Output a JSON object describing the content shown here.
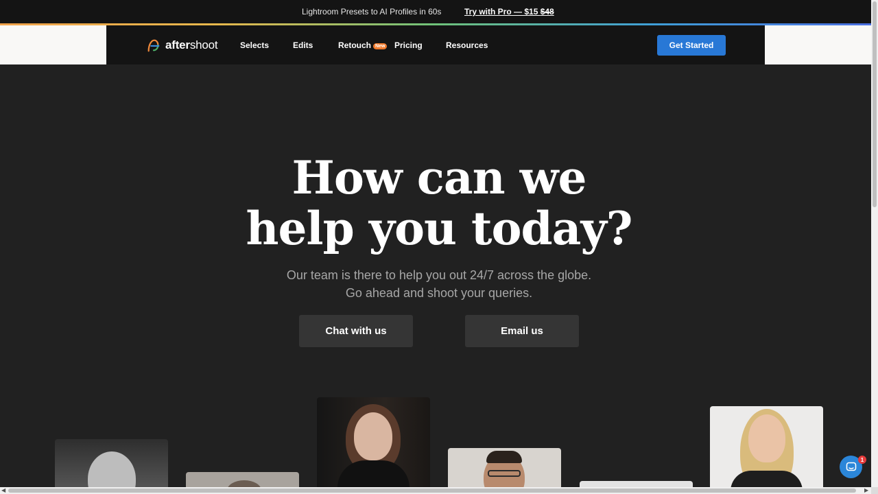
{
  "announcement": {
    "text": "Lightroom Presets to AI Profiles in 60s",
    "link_prefix": "Try with Pro — $15 ",
    "link_strike": "$48"
  },
  "nav": {
    "logo_bold": "after",
    "logo_regular": "shoot",
    "items": [
      "Selects",
      "Edits",
      "Retouch",
      "Pricing",
      "Resources"
    ],
    "new_badge": "New",
    "cta": "Get Started"
  },
  "hero": {
    "title_line1": "How can we",
    "title_line2": "help you today?",
    "subtitle_line1": "Our team is there to help you out 24/7 across the globe.",
    "subtitle_line2": "Go ahead and shoot your queries.",
    "chat_button": "Chat with us",
    "email_button": "Email us"
  },
  "chat_widget": {
    "unread_count": "1"
  },
  "colors": {
    "accent": "#2878d6",
    "background": "#212121",
    "nav_bg": "#141414",
    "badge": "#f07a2c"
  }
}
